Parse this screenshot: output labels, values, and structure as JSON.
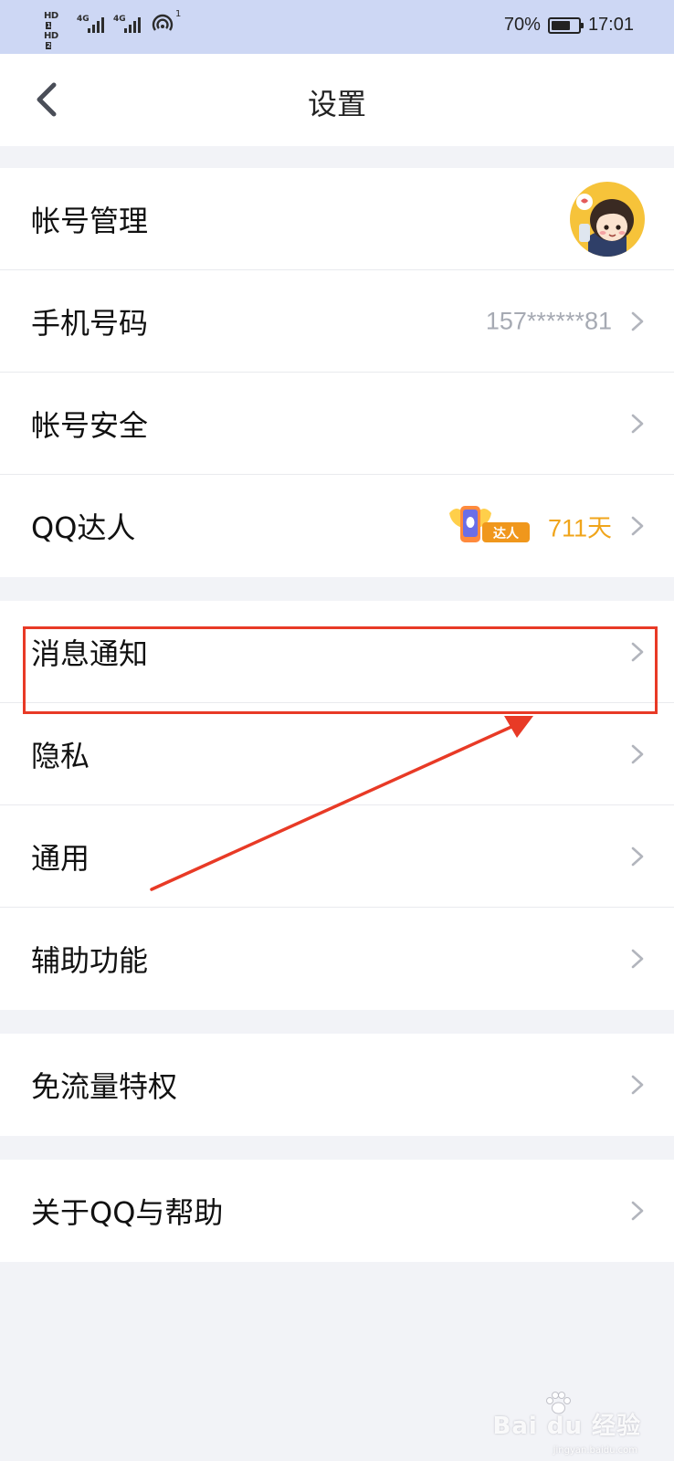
{
  "status_bar": {
    "hd1": "HD",
    "hd1_slot": "1",
    "hd2": "HD",
    "hd2_slot": "2",
    "net1": "4G",
    "net2": "4G",
    "hotspot_count": "1",
    "battery": "70%",
    "battery_level": 0.7,
    "time": "17:01"
  },
  "nav": {
    "title": "设置"
  },
  "groups": [
    {
      "items": [
        {
          "label": "帐号管理",
          "value": ""
        },
        {
          "label": "手机号码",
          "value": "157******81"
        },
        {
          "label": "帐号安全",
          "value": ""
        },
        {
          "label": "QQ达人",
          "badge_text": "达人",
          "value": "711天"
        }
      ]
    },
    {
      "items": [
        {
          "label": "消息通知"
        },
        {
          "label": "隐私"
        },
        {
          "label": "通用"
        },
        {
          "label": "辅助功能"
        }
      ]
    },
    {
      "items": [
        {
          "label": "免流量特权"
        }
      ]
    },
    {
      "items": [
        {
          "label": "关于QQ与帮助"
        }
      ]
    }
  ],
  "watermark": {
    "brand": "Bai du 经验",
    "url": "jingyan.baidu.com"
  },
  "colors": {
    "accent_annotation": "#e83a26",
    "days": "#f0a51b",
    "status_bar": "#cdd7f4"
  }
}
